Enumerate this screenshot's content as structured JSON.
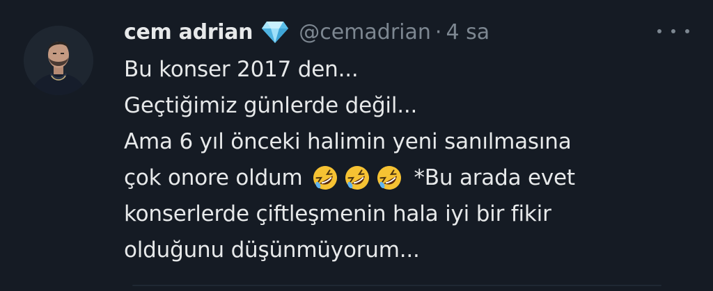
{
  "author": {
    "name": "cem adrian",
    "handle": "@cemadrian",
    "separator": "·",
    "time": "4 sa",
    "badge_icon": "diamond-icon",
    "avatar_icon": "profile-photo"
  },
  "more_icon": "more-horizontal-icon",
  "tweet": {
    "lines": [
      "Bu konser 2017 den...",
      "Geçtiğimiz günlerde değil...",
      "Ama 6 yıl önceki halimin yeni sanılmasına",
      "çok onore oldum",
      "*Bu arada evet",
      "konserlerde çiftleşmenin hala iyi bir fikir",
      "olduğunu düşünmüyorum..."
    ],
    "emojis": [
      "rolling-on-floor-laughing",
      "rolling-on-floor-laughing",
      "rolling-on-floor-laughing"
    ]
  },
  "colors": {
    "background": "#151b24",
    "text": "#e7e9ea",
    "muted": "#7d8791",
    "emoji": "#f6c233"
  }
}
